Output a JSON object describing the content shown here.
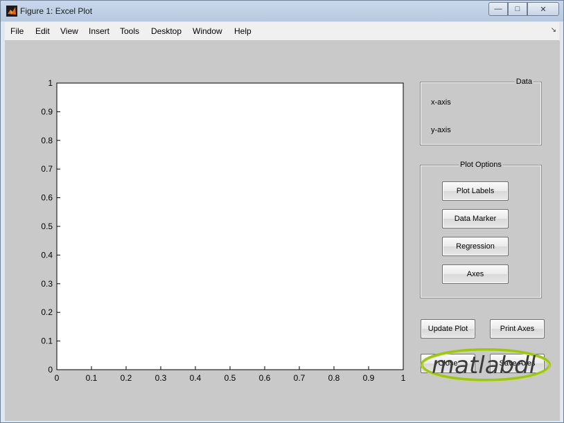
{
  "window": {
    "title": "Figure 1: Excel Plot"
  },
  "window_controls": {
    "minimize": "—",
    "maximize": "□",
    "close": "✕"
  },
  "menu": [
    "File",
    "Edit",
    "View",
    "Insert",
    "Tools",
    "Desktop",
    "Window",
    "Help"
  ],
  "axes": {
    "x_ticks": [
      "0",
      "0.1",
      "0.2",
      "0.3",
      "0.4",
      "0.5",
      "0.6",
      "0.7",
      "0.8",
      "0.9",
      "1"
    ],
    "y_ticks": [
      "0",
      "0.1",
      "0.2",
      "0.3",
      "0.4",
      "0.5",
      "0.6",
      "0.7",
      "0.8",
      "0.9",
      "1"
    ]
  },
  "data_panel": {
    "title": "Data",
    "x_label": "x-axis",
    "y_label": "y-axis"
  },
  "options_panel": {
    "title": "Plot Options",
    "buttons": [
      "Plot Labels",
      "Data Marker",
      "Regression",
      "Axes"
    ]
  },
  "actions": {
    "update": "Update Plot",
    "print": "Print Axes",
    "close": "Close",
    "save": "Save Axes"
  },
  "watermark": {
    "text": "matlabdl"
  },
  "chart_data": {
    "type": "scatter",
    "x": [],
    "y": [],
    "xlim": [
      0,
      1
    ],
    "ylim": [
      0,
      1
    ],
    "grid": false
  }
}
